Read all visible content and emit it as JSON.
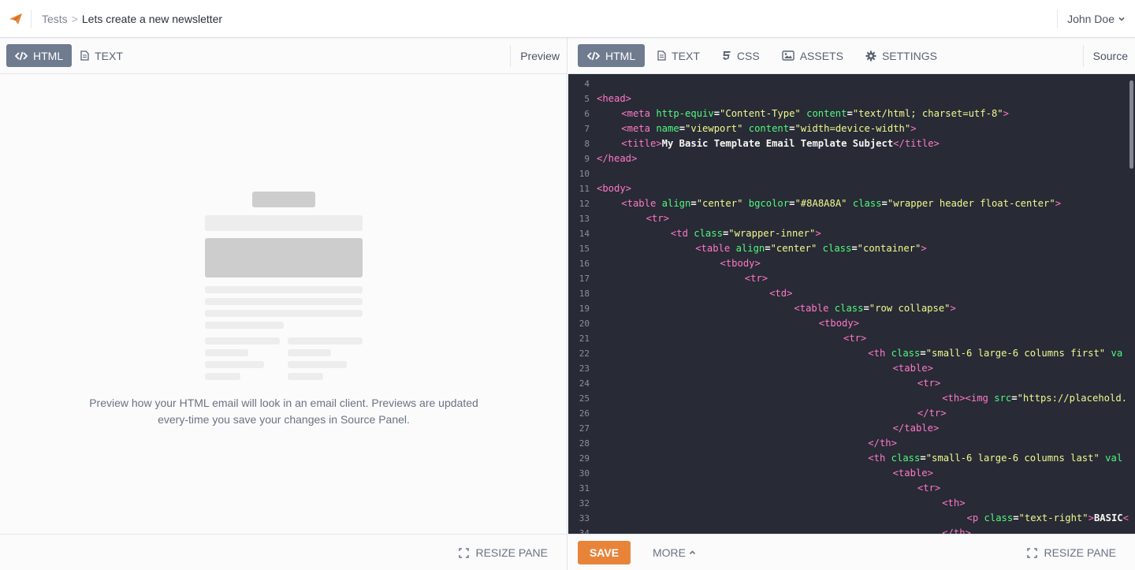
{
  "topbar": {
    "breadcrumb_parent": "Tests",
    "breadcrumb_sep": ">",
    "breadcrumb_current": "Lets create a new newsletter",
    "user_name": "John Doe",
    "accent_color": "#e8843a"
  },
  "left_pane": {
    "tabs": [
      {
        "label": "HTML",
        "icon": "code-icon",
        "active": true
      },
      {
        "label": "TEXT",
        "icon": "document-icon",
        "active": false
      }
    ],
    "pane_label": "Preview",
    "preview_message": "Preview how your HTML email will look in an email client. Previews are updated every-time you save your changes in Source Panel.",
    "resize_label": "RESIZE PANE"
  },
  "right_pane": {
    "tabs": [
      {
        "label": "HTML",
        "icon": "code-icon",
        "active": true
      },
      {
        "label": "TEXT",
        "icon": "document-icon",
        "active": false
      },
      {
        "label": "CSS",
        "icon": "css-icon",
        "active": false
      },
      {
        "label": "ASSETS",
        "icon": "image-icon",
        "active": false
      },
      {
        "label": "SETTINGS",
        "icon": "gear-icon",
        "active": false
      }
    ],
    "pane_label": "Source",
    "save_label": "SAVE",
    "more_label": "MORE",
    "resize_label": "RESIZE PANE"
  },
  "code_lines": [
    {
      "n": "4",
      "indent": 0,
      "parts": []
    },
    {
      "n": "5",
      "indent": 0,
      "parts": [
        [
          "tg",
          "<head>"
        ]
      ]
    },
    {
      "n": "6",
      "indent": 1,
      "parts": [
        [
          "tg",
          "<meta "
        ],
        [
          "at",
          "http-equiv"
        ],
        [
          "tx",
          "="
        ],
        [
          "st",
          "\"Content-Type\""
        ],
        [
          "tx",
          " "
        ],
        [
          "at",
          "content"
        ],
        [
          "tx",
          "="
        ],
        [
          "st",
          "\"text/html; charset=utf-8\""
        ],
        [
          "tg",
          ">"
        ]
      ]
    },
    {
      "n": "7",
      "indent": 1,
      "parts": [
        [
          "tg",
          "<meta "
        ],
        [
          "at",
          "name"
        ],
        [
          "tx",
          "="
        ],
        [
          "st",
          "\"viewport\""
        ],
        [
          "tx",
          " "
        ],
        [
          "at",
          "content"
        ],
        [
          "tx",
          "="
        ],
        [
          "st",
          "\"width=device-width\""
        ],
        [
          "tg",
          ">"
        ]
      ]
    },
    {
      "n": "8",
      "indent": 1,
      "parts": [
        [
          "tg",
          "<title>"
        ],
        [
          "tx",
          "My Basic Template Email Template Subject"
        ],
        [
          "tg",
          "</title>"
        ]
      ]
    },
    {
      "n": "9",
      "indent": 0,
      "parts": [
        [
          "tg",
          "</head>"
        ]
      ]
    },
    {
      "n": "10",
      "indent": 0,
      "parts": []
    },
    {
      "n": "11",
      "indent": 0,
      "parts": [
        [
          "tg",
          "<body>"
        ]
      ]
    },
    {
      "n": "12",
      "indent": 1,
      "parts": [
        [
          "tg",
          "<table "
        ],
        [
          "at",
          "align"
        ],
        [
          "tx",
          "="
        ],
        [
          "st",
          "\"center\""
        ],
        [
          "tx",
          " "
        ],
        [
          "at",
          "bgcolor"
        ],
        [
          "tx",
          "="
        ],
        [
          "st",
          "\"#8A8A8A\""
        ],
        [
          "tx",
          " "
        ],
        [
          "at",
          "class"
        ],
        [
          "tx",
          "="
        ],
        [
          "st",
          "\"wrapper header float-center\""
        ],
        [
          "tg",
          ">"
        ]
      ]
    },
    {
      "n": "13",
      "indent": 2,
      "parts": [
        [
          "tg",
          "<tr>"
        ]
      ]
    },
    {
      "n": "14",
      "indent": 3,
      "parts": [
        [
          "tg",
          "<td "
        ],
        [
          "at",
          "class"
        ],
        [
          "tx",
          "="
        ],
        [
          "st",
          "\"wrapper-inner\""
        ],
        [
          "tg",
          ">"
        ]
      ]
    },
    {
      "n": "15",
      "indent": 4,
      "parts": [
        [
          "tg",
          "<table "
        ],
        [
          "at",
          "align"
        ],
        [
          "tx",
          "="
        ],
        [
          "st",
          "\"center\""
        ],
        [
          "tx",
          " "
        ],
        [
          "at",
          "class"
        ],
        [
          "tx",
          "="
        ],
        [
          "st",
          "\"container\""
        ],
        [
          "tg",
          ">"
        ]
      ]
    },
    {
      "n": "16",
      "indent": 5,
      "parts": [
        [
          "tg",
          "<tbody>"
        ]
      ]
    },
    {
      "n": "17",
      "indent": 6,
      "parts": [
        [
          "tg",
          "<tr>"
        ]
      ]
    },
    {
      "n": "18",
      "indent": 7,
      "parts": [
        [
          "tg",
          "<td>"
        ]
      ]
    },
    {
      "n": "19",
      "indent": 8,
      "parts": [
        [
          "tg",
          "<table "
        ],
        [
          "at",
          "class"
        ],
        [
          "tx",
          "="
        ],
        [
          "st",
          "\"row collapse\""
        ],
        [
          "tg",
          ">"
        ]
      ]
    },
    {
      "n": "20",
      "indent": 9,
      "parts": [
        [
          "tg",
          "<tbody>"
        ]
      ]
    },
    {
      "n": "21",
      "indent": 10,
      "parts": [
        [
          "tg",
          "<tr>"
        ]
      ]
    },
    {
      "n": "22",
      "indent": 11,
      "parts": [
        [
          "tg",
          "<th "
        ],
        [
          "at",
          "class"
        ],
        [
          "tx",
          "="
        ],
        [
          "st",
          "\"small-6 large-6 columns first\""
        ],
        [
          "tx",
          " "
        ],
        [
          "at",
          "va"
        ]
      ]
    },
    {
      "n": "23",
      "indent": 12,
      "parts": [
        [
          "tg",
          "<table>"
        ]
      ]
    },
    {
      "n": "24",
      "indent": 13,
      "parts": [
        [
          "tg",
          "<tr>"
        ]
      ]
    },
    {
      "n": "25",
      "indent": 14,
      "parts": [
        [
          "tg",
          "<th>"
        ],
        [
          "tg",
          "<img "
        ],
        [
          "at",
          "src"
        ],
        [
          "tx",
          "="
        ],
        [
          "st",
          "\"https://placehold."
        ]
      ]
    },
    {
      "n": "26",
      "indent": 13,
      "parts": [
        [
          "tg",
          "</tr>"
        ]
      ]
    },
    {
      "n": "27",
      "indent": 12,
      "parts": [
        [
          "tg",
          "</table>"
        ]
      ]
    },
    {
      "n": "28",
      "indent": 11,
      "parts": [
        [
          "tg",
          "</th>"
        ]
      ]
    },
    {
      "n": "29",
      "indent": 11,
      "parts": [
        [
          "tg",
          "<th "
        ],
        [
          "at",
          "class"
        ],
        [
          "tx",
          "="
        ],
        [
          "st",
          "\"small-6 large-6 columns last\""
        ],
        [
          "tx",
          " "
        ],
        [
          "at",
          "val"
        ]
      ]
    },
    {
      "n": "30",
      "indent": 12,
      "parts": [
        [
          "tg",
          "<table>"
        ]
      ]
    },
    {
      "n": "31",
      "indent": 13,
      "parts": [
        [
          "tg",
          "<tr>"
        ]
      ]
    },
    {
      "n": "32",
      "indent": 14,
      "parts": [
        [
          "tg",
          "<th>"
        ]
      ]
    },
    {
      "n": "33",
      "indent": 15,
      "parts": [
        [
          "tg",
          "<p "
        ],
        [
          "at",
          "class"
        ],
        [
          "tx",
          "="
        ],
        [
          "st",
          "\"text-right\""
        ],
        [
          "tg",
          ">"
        ],
        [
          "tx",
          "BASIC"
        ],
        [
          "tg",
          "<"
        ]
      ]
    },
    {
      "n": "34",
      "indent": 14,
      "parts": [
        [
          "tg",
          "</th>"
        ]
      ]
    }
  ]
}
